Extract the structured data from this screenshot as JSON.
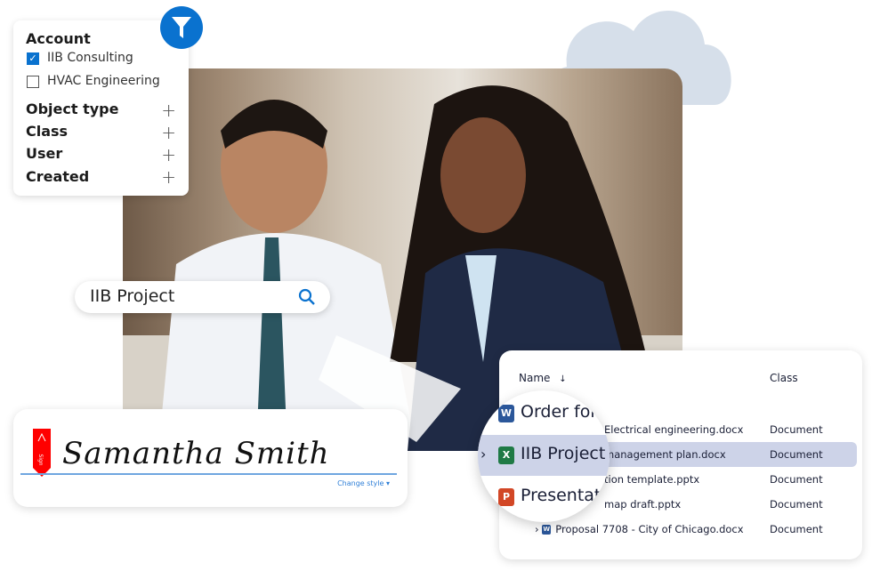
{
  "filter": {
    "icon": "funnel-icon",
    "account_heading": "Account",
    "accounts": [
      {
        "label": "IIB Consulting",
        "checked": true
      },
      {
        "label": "HVAC Engineering",
        "checked": false
      }
    ],
    "sections": [
      "Object type",
      "Class",
      "User",
      "Created"
    ]
  },
  "search": {
    "value": "IIB Project",
    "icon": "search-icon"
  },
  "signature": {
    "name": "Samantha Smith",
    "change_style": "Change style ▾",
    "badge": "Sign"
  },
  "table": {
    "headers": {
      "name": "Name",
      "class": "Class"
    },
    "rows": [
      {
        "name": "Electrical engineering.docx",
        "class": "Document"
      },
      {
        "name": "management plan.docx",
        "class": "Document",
        "selected": true
      },
      {
        "name": "tion template.pptx",
        "class": "Document"
      },
      {
        "name": "map draft.pptx",
        "class": "Document"
      },
      {
        "name": "Proposal 7708 - City of Chicago.docx",
        "class": "Document"
      }
    ],
    "magnified": [
      {
        "icon": "W",
        "label": "Order for",
        "color": "#2b579a"
      },
      {
        "icon": "X",
        "label": "IIB Project",
        "color": "#1f7a45"
      },
      {
        "icon": "P",
        "label": "Presentat",
        "color": "#d24726"
      }
    ]
  },
  "colors": {
    "accent": "#0a72cf",
    "selected_row": "#cdd3e8",
    "cloud": "#d6dfea"
  }
}
